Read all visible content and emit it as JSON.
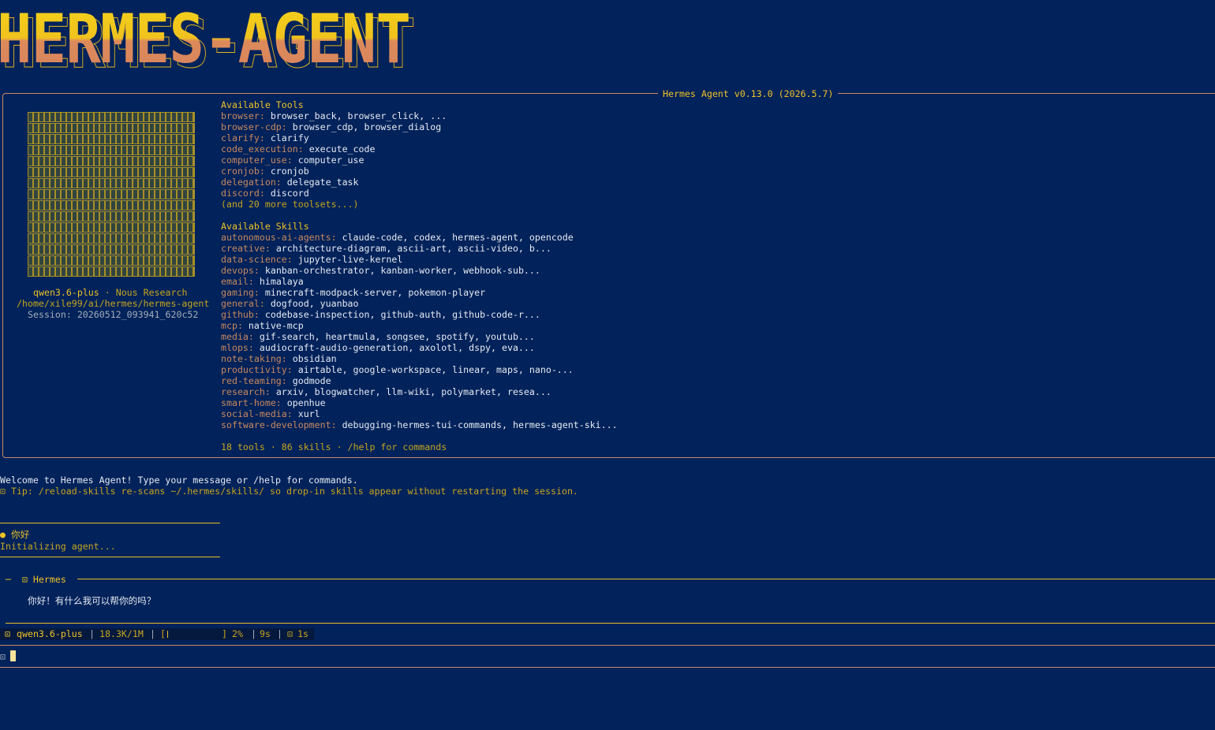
{
  "banner": {
    "title": "HERMES-AGENT"
  },
  "panel": {
    "title": "Hermes Agent v0.13.0 (2026.5.7)",
    "identity": {
      "model": "qwen3.6-plus",
      "sep": "·",
      "provider": "Nous Research",
      "path": "/home/xile99/ai/hermes/hermes-agent",
      "session": "Session: 20260512_093941_620c52"
    },
    "tools": {
      "heading": "Available Tools",
      "items": [
        {
          "key": "browser:",
          "value": "browser_back, browser_click, ..."
        },
        {
          "key": "browser-cdp:",
          "value": "browser_cdp, browser_dialog"
        },
        {
          "key": "clarify:",
          "value": "clarify"
        },
        {
          "key": "code_execution:",
          "value": "execute_code"
        },
        {
          "key": "computer_use:",
          "value": "computer_use"
        },
        {
          "key": "cronjob:",
          "value": "cronjob"
        },
        {
          "key": "delegation:",
          "value": "delegate_task"
        },
        {
          "key": "discord:",
          "value": "discord"
        }
      ],
      "more": "(and 20 more toolsets...)"
    },
    "skills": {
      "heading": "Available Skills",
      "items": [
        {
          "key": "autonomous-ai-agents:",
          "value": "claude-code, codex, hermes-agent, opencode"
        },
        {
          "key": "creative:",
          "value": "architecture-diagram, ascii-art, ascii-video, b..."
        },
        {
          "key": "data-science:",
          "value": "jupyter-live-kernel"
        },
        {
          "key": "devops:",
          "value": "kanban-orchestrator, kanban-worker, webhook-sub..."
        },
        {
          "key": "email:",
          "value": "himalaya"
        },
        {
          "key": "gaming:",
          "value": "minecraft-modpack-server, pokemon-player"
        },
        {
          "key": "general:",
          "value": "dogfood, yuanbao"
        },
        {
          "key": "github:",
          "value": "codebase-inspection, github-auth, github-code-r..."
        },
        {
          "key": "mcp:",
          "value": "native-mcp"
        },
        {
          "key": "media:",
          "value": "gif-search, heartmula, songsee, spotify, youtub..."
        },
        {
          "key": "mlops:",
          "value": "audiocraft-audio-generation, axolotl, dspy, eva..."
        },
        {
          "key": "note-taking:",
          "value": "obsidian"
        },
        {
          "key": "productivity:",
          "value": "airtable, google-workspace, linear, maps, nano-..."
        },
        {
          "key": "red-teaming:",
          "value": "godmode"
        },
        {
          "key": "research:",
          "value": "arxiv, blogwatcher, llm-wiki, polymarket, resea..."
        },
        {
          "key": "smart-home:",
          "value": "openhue"
        },
        {
          "key": "social-media:",
          "value": "xurl"
        },
        {
          "key": "software-development:",
          "value": "debugging-hermes-tui-commands, hermes-agent-ski..."
        }
      ]
    },
    "summary": "18 tools · 86 skills · /help for commands"
  },
  "welcome": "Welcome to Hermes Agent! Type your message or /help for commands.",
  "tip": "⊡ Tip: /reload-skills re-scans ~/.hermes/skills/ so drop-in skills appear without restarting the session.",
  "user_message": {
    "bullet": "●",
    "text": "你好"
  },
  "init_status": "Initializing agent...",
  "reply": {
    "header_dash": "─",
    "header_icon": "⊡",
    "speaker": "Hermes",
    "text": "你好！有什么我可以帮你的吗？"
  },
  "status": {
    "icon": "⊡",
    "model": "qwen3.6-plus",
    "tokens": "18.3K/1M",
    "bar_open": "[",
    "bar_close": "]",
    "context_percent": 2,
    "percent_label": "2%",
    "elapsed": "9s",
    "timer_icon": "⊡",
    "timer": "1s"
  },
  "input": {
    "prompt_icon": "⊡",
    "value": ""
  },
  "colors": {
    "background": "#01225a",
    "accent": "#efc227",
    "muted": "#c7a51e",
    "frame": "#c98c6a"
  }
}
